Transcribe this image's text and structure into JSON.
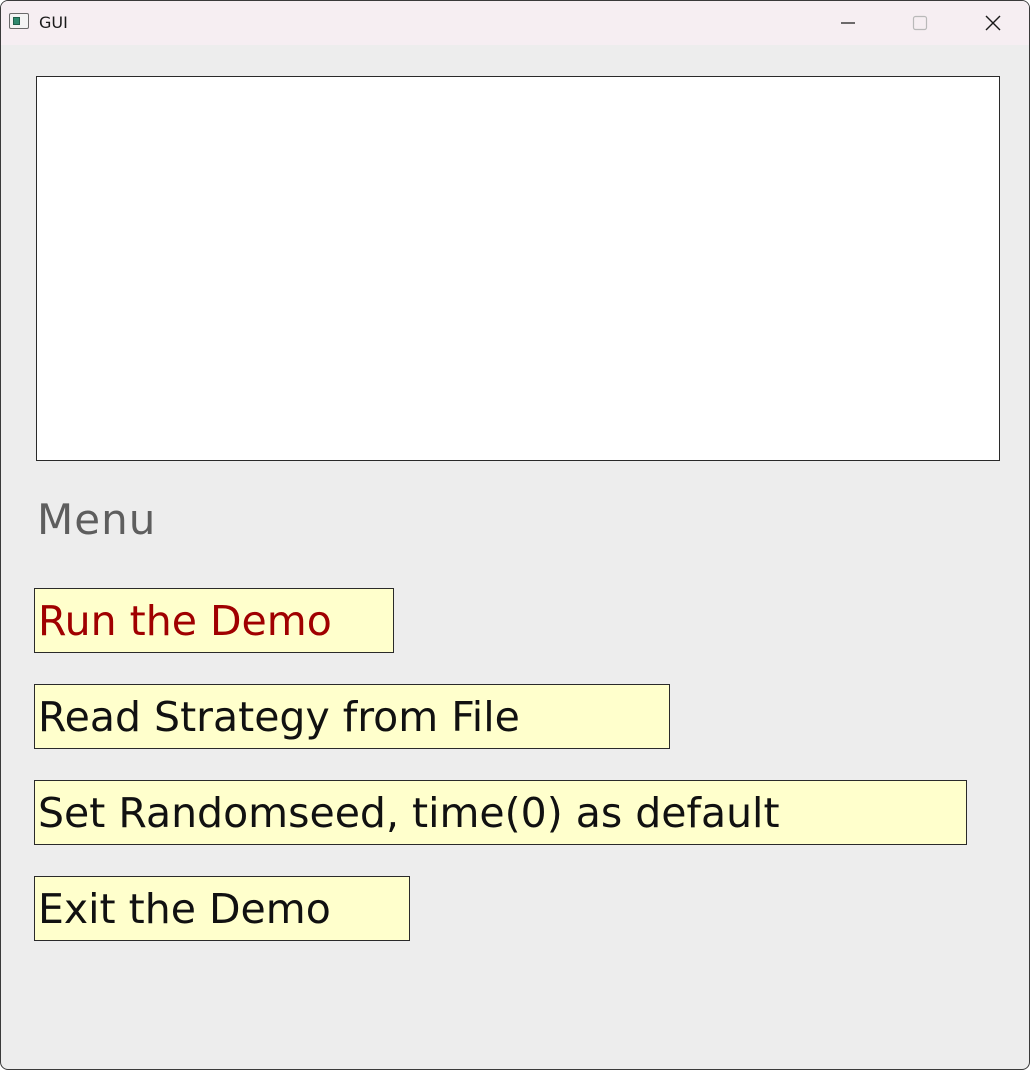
{
  "window": {
    "title": "GUI",
    "icon": "app-window-icon",
    "controls": {
      "minimize_icon": "minimize-icon",
      "maximize_icon": "maximize-icon",
      "close_icon": "close-icon"
    }
  },
  "canvas": {
    "content": ""
  },
  "menu": {
    "label": "Menu",
    "items": [
      {
        "label": "Run the Demo",
        "color": "#a00000"
      },
      {
        "label": "Read Strategy from File",
        "color": "#111111"
      },
      {
        "label": "Set Randomseed, time(0) as default",
        "color": "#111111"
      },
      {
        "label": "Exit the Demo",
        "color": "#111111"
      }
    ],
    "button_background": "#ffffcc"
  }
}
